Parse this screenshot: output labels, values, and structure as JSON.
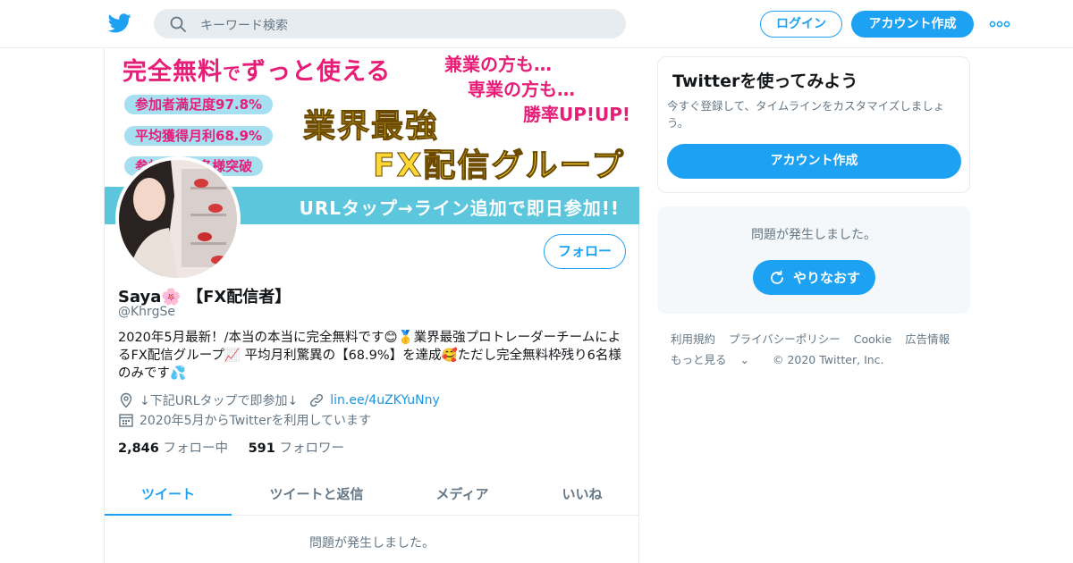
{
  "topbar": {
    "search_placeholder": "キーワード検索",
    "login_label": "ログイン",
    "signup_label": "アカウント作成"
  },
  "banner": {
    "title_a": "完全無料",
    "title_b": "で",
    "title_c": "ずっと使える",
    "right_line1": "兼業の方も…",
    "right_line2": "専業の方も…",
    "right_line3": "勝率UP!UP!",
    "pill1": "参加者満足度97.8%",
    "pill2": "平均獲得月利68.9%",
    "pill3": "参加者○○名様突破",
    "big1": "業界最強",
    "big2": "FX配信グループ",
    "stripe": "URLタップ→ライン追加で即日参加!!"
  },
  "profile": {
    "follow_label": "フォロー",
    "name": "Saya🌸 【FX配信者】",
    "handle": "@KhrgSe",
    "bio": "2020年5月最新！/本当の本当に完全無料です😊🥇業界最強プロトレーダーチームによるFX配信グループ📈 平均月利驚異の【68.9%】を達成🥰ただし完全無料枠残り6名様のみです💦",
    "location": "↓下記URLタップで即参加↓",
    "url": "lin.ee/4uZKYuNny",
    "joined": "2020年5月からTwitterを利用しています",
    "following_count": "2,846",
    "following_label": "フォロー中",
    "followers_count": "591",
    "followers_label": "フォロワー"
  },
  "tabs": [
    "ツイート",
    "ツイートと返信",
    "メディア",
    "いいね"
  ],
  "timeline_error": "問題が発生しました。",
  "signup_card": {
    "title": "Twitterを使ってみよう",
    "text": "今すぐ登録して、タイムラインをカスタマイズしましょう。",
    "button": "アカウント作成"
  },
  "error_card": {
    "message": "問題が発生しました。",
    "retry": "やりなおす"
  },
  "footer": {
    "links": [
      "利用規約",
      "プライバシーポリシー",
      "Cookie",
      "広告情報"
    ],
    "more": "もっと見る",
    "copyright": "© 2020 Twitter, Inc."
  },
  "colors": {
    "accent": "#1da1f2",
    "muted": "#657786",
    "banner_pink": "#e61e78",
    "banner_stripe": "#5cc6dc"
  }
}
